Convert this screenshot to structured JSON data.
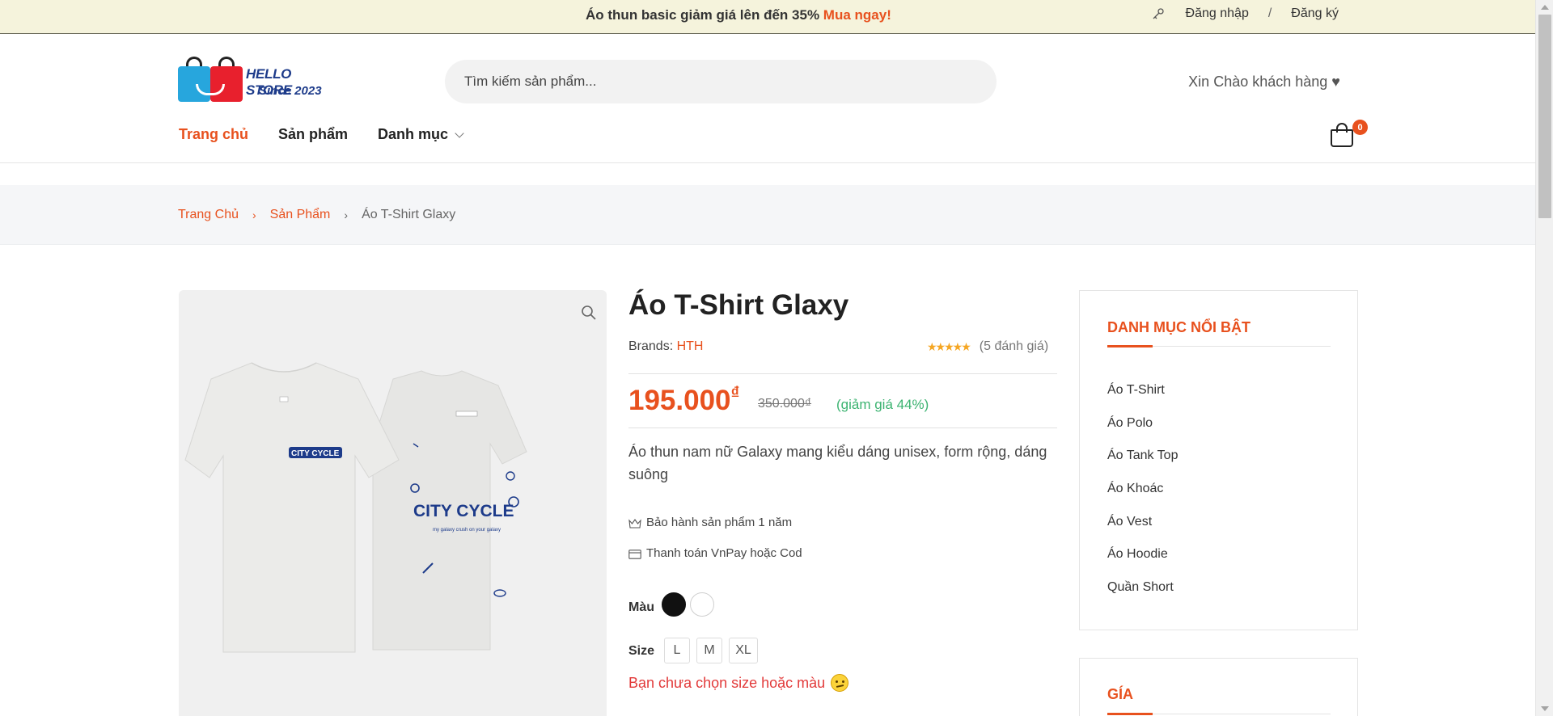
{
  "topbar": {
    "promo_text": "Áo thun basic giảm giá lên đến 35%",
    "promo_cta": "Mua ngay!",
    "login": "Đăng nhập",
    "separator": "/",
    "register": "Đăng ký"
  },
  "header": {
    "logo_name": "HELLO STORE",
    "logo_since": "Since 2023",
    "search_placeholder": "Tìm kiếm sản phẩm...",
    "greeting": "Xin Chào khách hàng ♥",
    "cart_count": "0"
  },
  "nav": {
    "items": [
      {
        "label": "Trang chủ",
        "active": true
      },
      {
        "label": "Sản phẩm",
        "active": false
      },
      {
        "label": "Danh mục",
        "active": false
      }
    ]
  },
  "breadcrumb": {
    "home": "Trang Chủ",
    "products": "Sản Phẩm",
    "current": "Áo T-Shirt Glaxy",
    "arrow": "›"
  },
  "product": {
    "title": "Áo T-Shirt Glaxy",
    "brand_label": "Brands:",
    "brand_value": "HTH",
    "rating": 4.5,
    "stars": "★★★★★",
    "reviews": "(5 đánh giá)",
    "price": "195.000",
    "currency": "₫",
    "old_price": "350.000₫",
    "discount": "(giảm giá 44%)",
    "description": "Áo thun nam nữ Galaxy mang kiểu dáng unisex, form rộng, dáng suông",
    "perks": [
      {
        "icon": "crown-icon",
        "text": "Bảo hành sản phẩm 1 năm"
      },
      {
        "icon": "credit-card-icon",
        "text": "Thanh toán VnPay hoặc Cod"
      }
    ],
    "color_label": "Màu",
    "colors": [
      "#111111",
      "#ffffff"
    ],
    "size_label": "Size",
    "sizes": [
      "L",
      "M",
      "XL"
    ],
    "warning": "Bạn chưa chọn size hoặc màu",
    "image_text_small": "CITY CYCLE",
    "image_text_large": "CITY CYCLE",
    "image_tagline": "my galaxy crush on your galaxy"
  },
  "sidebar": {
    "categories_heading": "DANH MỤC NỔI BẬT",
    "categories": [
      "Áo T-Shirt",
      "Áo Polo",
      "Áo Tank Top",
      "Áo Khoác",
      "Áo Vest",
      "Áo Hoodie",
      "Quần Short"
    ],
    "price_heading": "GÍA"
  },
  "colors": {
    "accent": "#e8511e",
    "topbar_bg": "#f5f3dc",
    "discount": "#3cb371",
    "warning": "#e23a3a",
    "brand_blue": "#1d3b8a"
  }
}
